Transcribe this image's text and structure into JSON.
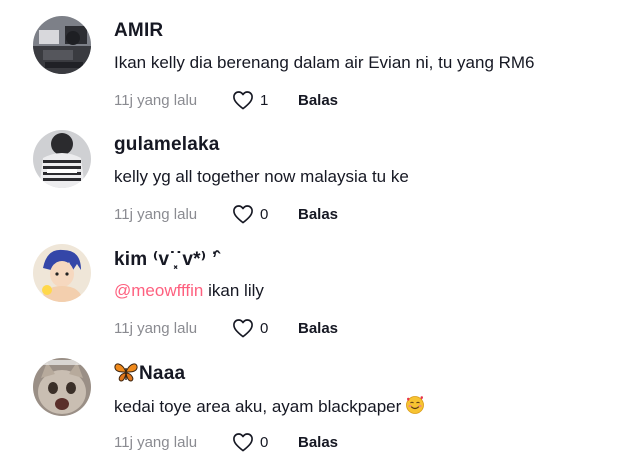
{
  "comments": [
    {
      "username": "AMIR",
      "text": "Ikan kelly dia berenang dalam air Evian ni, tu yang RM6",
      "time": "11j yang lalu",
      "likes": "1",
      "reply_label": "Balas",
      "avatar_icon": "dark-desk-photo-avatar"
    },
    {
      "username": "gulamelaka",
      "text": "kelly yg all together now malaysia tu ke",
      "time": "11j yang lalu",
      "likes": "0",
      "reply_label": "Balas",
      "avatar_icon": "striped-shirt-photo-avatar"
    },
    {
      "username": "kim ⁽ᴠ˙͓˙ᴠ*⁾ ʼ̂",
      "mention": "@meowfffin",
      "text": " ikan lily",
      "time": "11j yang lalu",
      "likes": "0",
      "reply_label": "Balas",
      "avatar_icon": "anime-boy-avatar"
    },
    {
      "username": "Naaa",
      "username_prefix_icon": "butterfly-emoji",
      "text": "kedai toye area aku, ayam blackpaper",
      "text_suffix_icon": "smiling-face-with-hearts-emoji",
      "time": "11j yang lalu",
      "likes": "0",
      "reply_label": "Balas",
      "avatar_icon": "cat-photo-avatar"
    }
  ],
  "colors": {
    "text": "#161823",
    "muted": "#8a8b91",
    "mention": "#fe2c55",
    "background": "#ffffff"
  }
}
